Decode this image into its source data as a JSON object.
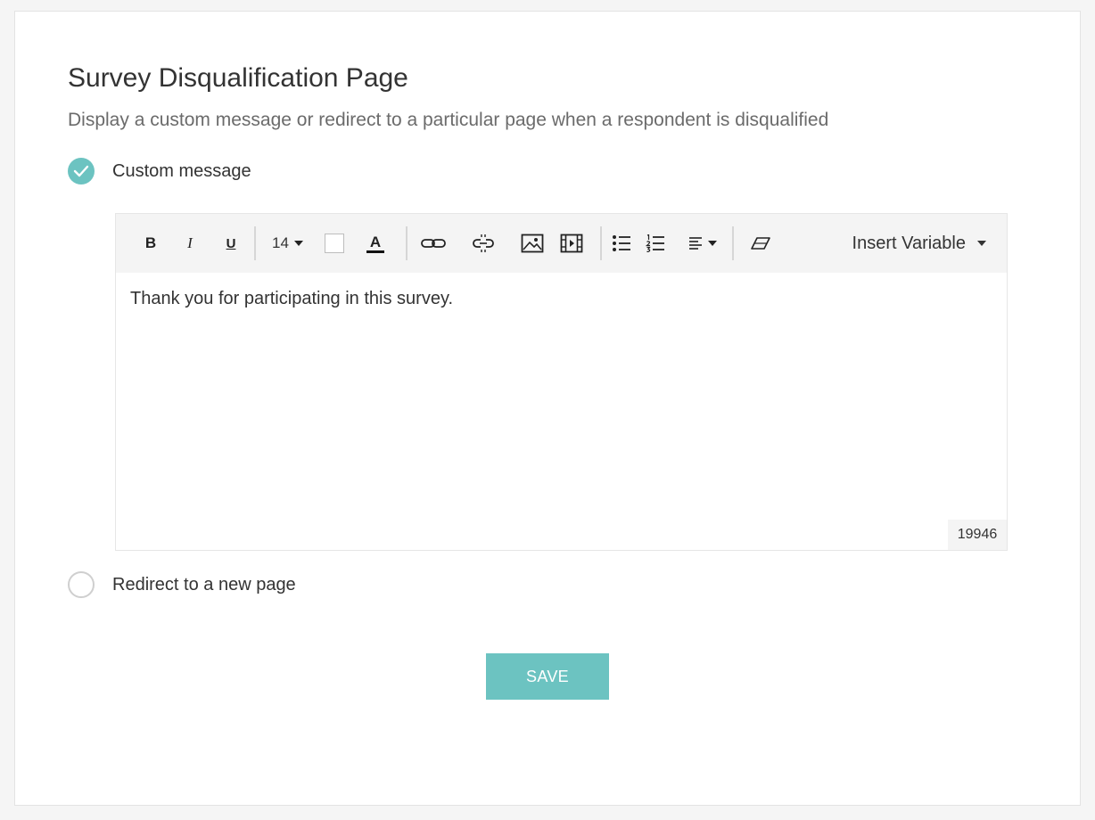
{
  "page": {
    "title": "Survey Disqualification Page",
    "subtitle": "Display a custom message or redirect to a particular page when a respondent is disqualified"
  },
  "options": {
    "custom_message": {
      "label": "Custom message",
      "selected": true
    },
    "redirect": {
      "label": "Redirect to a new page",
      "selected": false
    }
  },
  "editor": {
    "toolbar": {
      "bold_label": "B",
      "italic_label": "I",
      "underline_label": "U",
      "font_size": "14",
      "font_color_label": "A",
      "insert_variable_label": "Insert Variable",
      "icons": [
        "bold-icon",
        "italic-icon",
        "underline-icon",
        "font-size-dropdown",
        "background-color-swatch",
        "font-color-icon",
        "link-icon",
        "unlink-icon",
        "image-icon",
        "video-icon",
        "bulleted-list-icon",
        "numbered-list-icon",
        "align-icon",
        "eraser-icon"
      ]
    },
    "content": "Thank you for participating in this survey.",
    "char_count": "19946"
  },
  "save_label": "SAVE",
  "colors": {
    "accent": "#6cc3c1",
    "toolbar_bg": "#f4f4f4",
    "text": "#333333",
    "subtitle_text": "#6b6b6b"
  }
}
